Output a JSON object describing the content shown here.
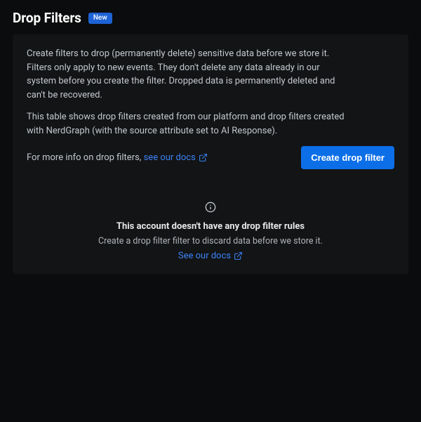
{
  "header": {
    "title": "Drop Filters",
    "badge": "New"
  },
  "panel": {
    "desc1": "Create filters to drop (permanently delete) sensitive data before we store it. Filters only apply to new events. They don't delete any data already in our system before you create the filter. Dropped data is permanently deleted and can't be recovered.",
    "desc2": "This table shows drop filters created from our platform and drop filters created with NerdGraph (with the source attribute set to AI Response).",
    "more_info_prefix": "For more info on drop filters, ",
    "docs_link": "see our docs",
    "create_button": "Create drop filter"
  },
  "empty": {
    "title": "This account doesn't have any drop filter rules",
    "subtitle": "Create a drop filter filter to discard data before we store it.",
    "docs_link": "See our docs"
  },
  "colors": {
    "accent": "#0c6fe8",
    "link": "#3b82f6",
    "panel_bg": "#131415",
    "page_bg": "#0b0c0d"
  }
}
